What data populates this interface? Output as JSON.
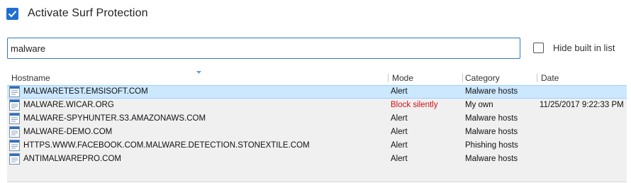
{
  "activate": {
    "label": "Activate Surf Protection",
    "checked": true
  },
  "search": {
    "value": "malware",
    "placeholder": ""
  },
  "hide_builtin": {
    "label": "Hide built in list",
    "checked": false
  },
  "table": {
    "columns": [
      "Hostname",
      "Mode",
      "Category",
      "Date"
    ],
    "rows": [
      {
        "hostname": "MALWARETEST.EMSISOFT.COM",
        "mode": "Alert",
        "category": "Malware hosts",
        "date": "",
        "selected": true
      },
      {
        "hostname": "MALWARE.WICAR.ORG",
        "mode": "Block silently",
        "category": "My own",
        "date": "11/25/2017 9:22:33 PM",
        "selected": false
      },
      {
        "hostname": "MALWARE-SPYHUNTER.S3.AMAZONAWS.COM",
        "mode": "Alert",
        "category": "Malware hosts",
        "date": "",
        "selected": false
      },
      {
        "hostname": "MALWARE-DEMO.COM",
        "mode": "Alert",
        "category": "Malware hosts",
        "date": "",
        "selected": false
      },
      {
        "hostname": "HTTPS.WWW.FACEBOOK.COM.MALWARE.DETECTION.STONEXTILE.COM",
        "mode": "Alert",
        "category": "Phishing hosts",
        "date": "",
        "selected": false
      },
      {
        "hostname": "ANTIMALWAREPRO.COM",
        "mode": "Alert",
        "category": "Malware hosts",
        "date": "",
        "selected": false
      }
    ]
  },
  "colors": {
    "accent": "#1f6fd0",
    "selection": "#cce8ff",
    "block_silently": "#d01010"
  }
}
